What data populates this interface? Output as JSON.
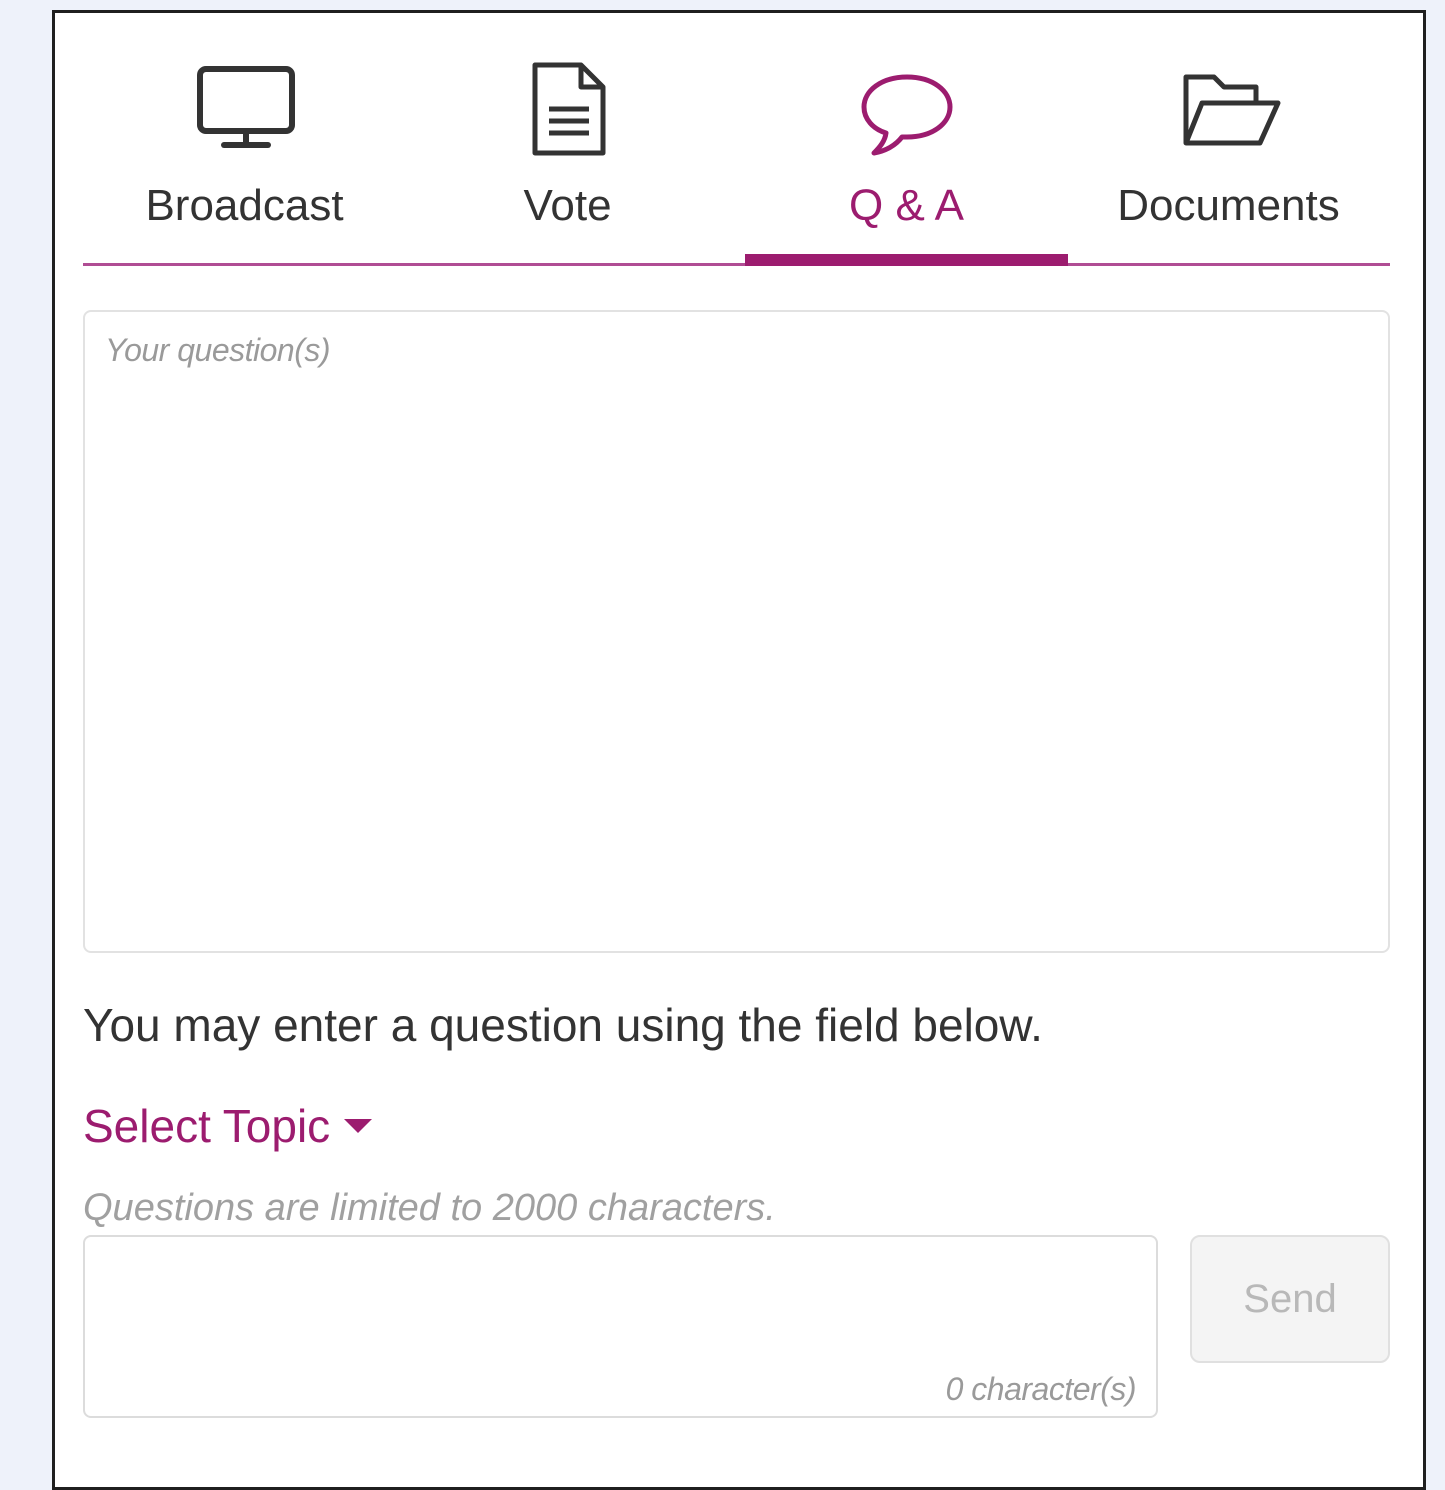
{
  "tabs": [
    {
      "label": "Broadcast",
      "icon": "monitor-icon",
      "active": false
    },
    {
      "label": "Vote",
      "icon": "document-icon",
      "active": false
    },
    {
      "label": "Q & A",
      "icon": "speech-bubble-icon",
      "active": true
    },
    {
      "label": "Documents",
      "icon": "folder-open-icon",
      "active": false
    }
  ],
  "question_area": {
    "placeholder": "Your question(s)"
  },
  "instructions": "You may enter a question using the field below.",
  "topic_select": {
    "label": "Select Topic"
  },
  "limit_note": "Questions are limited to 2000  characters.",
  "input": {
    "value": "",
    "char_count": "0 character(s)"
  },
  "send_button": {
    "label": "Send",
    "disabled": true
  },
  "colors": {
    "accent": "#9c1c6f",
    "accent_light": "#b04d94",
    "text": "#333333",
    "muted": "#9a9a9a",
    "page_background": "#eef2fa"
  }
}
